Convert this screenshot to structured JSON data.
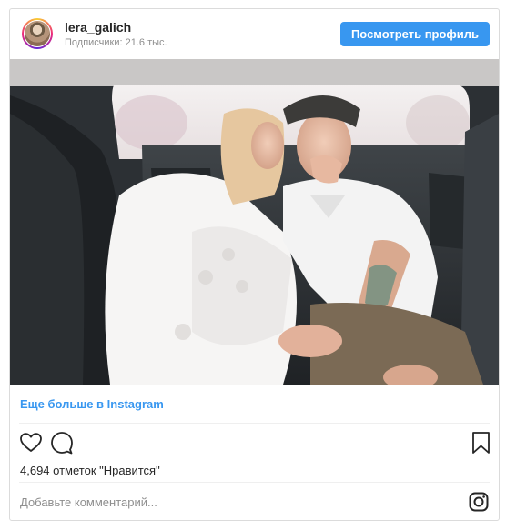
{
  "header": {
    "username": "lera_galich",
    "followers": "Подписчики: 21.6 тыс.",
    "profile_button": "Посмотреть профиль"
  },
  "more_link": "Еще больше в Instagram",
  "actions": {
    "like_icon": "heart-icon",
    "comment_icon": "comment-icon",
    "save_icon": "bookmark-icon"
  },
  "likes_text": "4,694 отметок \"Нравится\"",
  "comment_placeholder": "Добавьте комментарий...",
  "brand_icon": "instagram-icon",
  "colors": {
    "accent": "#3897f0",
    "text": "#262626",
    "muted": "#8e8e8e",
    "border": "#dbdbdb"
  }
}
